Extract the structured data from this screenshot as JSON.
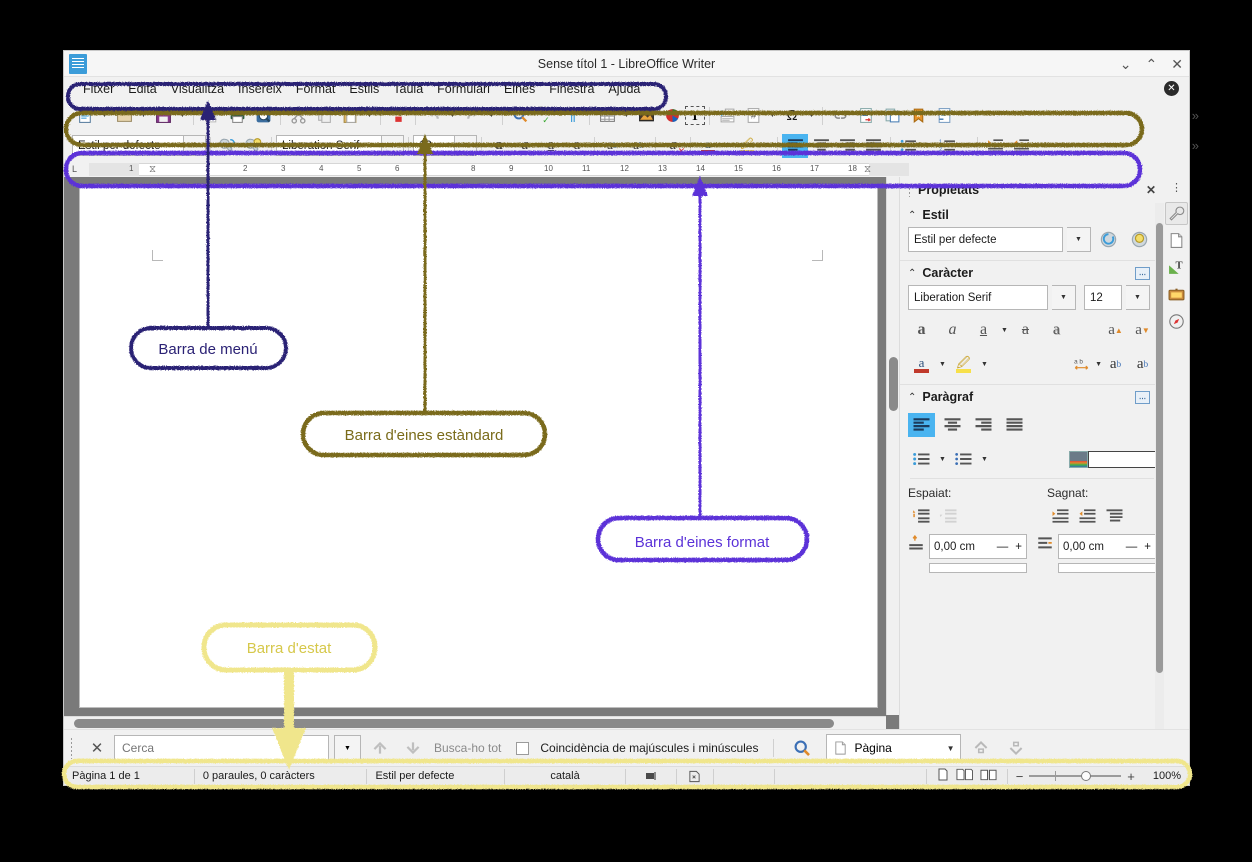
{
  "window": {
    "title": "Sense títol 1 - LibreOffice Writer",
    "app_icon": "writer-document-icon",
    "controls": {
      "minimize": "⌄",
      "maximize": "⌃",
      "close": "✕",
      "doc_close": "✕"
    }
  },
  "menubar": {
    "items": [
      "Fitxer",
      "Edita",
      "Visualitza",
      "Insereix",
      "Format",
      "Estils",
      "Taula",
      "Formulari",
      "Eines",
      "Finestra",
      "Ajuda"
    ]
  },
  "standard_toolbar": {
    "overflow": "»",
    "items": [
      {
        "name": "new-document-icon",
        "glyph": "🗎",
        "dropdown": true
      },
      {
        "name": "open-document-icon",
        "glyph": "📁",
        "dropdown": true
      },
      {
        "name": "save-document-icon",
        "glyph": "💾",
        "dropdown": true
      },
      {
        "sep": true
      },
      {
        "name": "export-pdf-icon",
        "glyph": "◣",
        "dropdown": false
      },
      {
        "name": "print-icon",
        "glyph": "🖨",
        "dropdown": false
      },
      {
        "name": "print-preview-icon",
        "glyph": "🔍",
        "dropdown": false
      },
      {
        "sep": true
      },
      {
        "name": "cut-icon",
        "glyph": "✂",
        "dropdown": false
      },
      {
        "name": "copy-icon",
        "glyph": "⧉",
        "dropdown": false
      },
      {
        "name": "paste-icon",
        "glyph": "📋",
        "dropdown": true
      },
      {
        "sep": true
      },
      {
        "name": "clone-formatting-icon",
        "glyph": "🖌",
        "dropdown": false
      },
      {
        "sep": true
      },
      {
        "name": "undo-icon",
        "glyph": "↺",
        "dropdown": true
      },
      {
        "name": "redo-icon",
        "glyph": "↻",
        "dropdown": true
      },
      {
        "sep": true
      },
      {
        "name": "find-replace-icon",
        "glyph": "🔍",
        "dropdown": false
      },
      {
        "name": "spelling-icon",
        "glyph": "Abc",
        "dropdown": false
      },
      {
        "name": "formatting-marks-icon",
        "glyph": "¶",
        "dropdown": false
      },
      {
        "sep": true
      },
      {
        "name": "insert-table-icon",
        "glyph": "⊞",
        "dropdown": true
      },
      {
        "name": "insert-image-icon",
        "glyph": "🖼",
        "dropdown": false
      },
      {
        "name": "insert-chart-icon",
        "glyph": "◕",
        "dropdown": false
      },
      {
        "name": "insert-text-box-icon",
        "glyph": "T",
        "dropdown": false
      },
      {
        "sep": true
      },
      {
        "name": "page-break-icon",
        "glyph": "▤",
        "dropdown": false
      },
      {
        "name": "insert-field-icon",
        "glyph": "#",
        "dropdown": true
      },
      {
        "name": "special-character-icon",
        "glyph": "Ω",
        "dropdown": true
      },
      {
        "sep": true
      },
      {
        "name": "insert-hyperlink-icon",
        "glyph": "⛓",
        "dropdown": false
      },
      {
        "name": "insert-footnote-icon",
        "glyph": "🗐",
        "dropdown": false
      },
      {
        "name": "insert-endnote-icon",
        "glyph": "🗏",
        "dropdown": false
      },
      {
        "name": "insert-bookmark-icon",
        "glyph": "🔖",
        "dropdown": false
      },
      {
        "name": "insert-cross-reference-icon",
        "glyph": "🗒",
        "dropdown": false
      }
    ]
  },
  "format_toolbar": {
    "overflow": "»",
    "paragraph_style": "Estil per defecte",
    "font_name": "Liberation Serif",
    "font_size": "12",
    "items": [
      {
        "name": "update-style-icon",
        "glyph": "⟳"
      },
      {
        "name": "new-style-icon",
        "glyph": "☆"
      },
      {
        "name": "bold-icon",
        "glyph": "a"
      },
      {
        "name": "italic-icon",
        "glyph": "𝑎"
      },
      {
        "name": "underline-icon",
        "glyph": "a",
        "dropdown": true
      },
      {
        "name": "strikethrough-icon",
        "glyph": "a"
      },
      {
        "name": "shadow-icon",
        "glyph": "a"
      },
      {
        "name": "superscript-icon",
        "glyph": "ab"
      },
      {
        "name": "subscript-icon",
        "glyph": "ab"
      },
      {
        "name": "clear-formatting-icon",
        "glyph": "a"
      },
      {
        "name": "font-color-icon",
        "glyph": "a",
        "dropdown": true
      },
      {
        "name": "highlight-color-icon",
        "glyph": "🖉",
        "dropdown": true
      },
      {
        "name": "align-left-icon",
        "glyph": "≡",
        "active": true
      },
      {
        "name": "align-center-icon",
        "glyph": "≡"
      },
      {
        "name": "align-right-icon",
        "glyph": "≡"
      },
      {
        "name": "align-justified-icon",
        "glyph": "≡"
      },
      {
        "name": "unordered-list-icon",
        "glyph": "⁞≡",
        "dropdown": true
      },
      {
        "name": "ordered-list-icon",
        "glyph": "1≡",
        "dropdown": true
      },
      {
        "name": "increase-indent-icon",
        "glyph": "≡"
      },
      {
        "name": "decrease-indent-icon",
        "glyph": "≡"
      }
    ]
  },
  "ruler": {
    "ticks": [
      "1",
      "1",
      "2",
      "3",
      "4",
      "5",
      "6",
      "8",
      "9",
      "10",
      "11",
      "12",
      "13",
      "14",
      "15",
      "16",
      "17",
      "18"
    ],
    "left_corner": "L"
  },
  "sidebar": {
    "title": "Propietats",
    "close_label": "✕",
    "menu_glyph": "⋮",
    "sections": {
      "style": {
        "title": "Estil",
        "value": "Estil per defecte",
        "buttons": [
          {
            "name": "update-selected-style-icon",
            "glyph": "⟳"
          },
          {
            "name": "new-style-from-selection-icon",
            "glyph": "☆"
          }
        ]
      },
      "character": {
        "title": "Caràcter",
        "font_name": "Liberation Serif",
        "font_size": "12",
        "row1": [
          {
            "name": "bold-icon",
            "glyph": "a"
          },
          {
            "name": "italic-icon",
            "glyph": "𝑎"
          },
          {
            "name": "underline-icon",
            "glyph": "a",
            "dropdown": true
          },
          {
            "name": "strikethrough-icon",
            "glyph": "a"
          },
          {
            "name": "shadow-icon",
            "glyph": "a"
          }
        ],
        "row1_right": [
          {
            "name": "increase-font-size-icon",
            "glyph": "a"
          },
          {
            "name": "decrease-font-size-icon",
            "glyph": "a"
          }
        ],
        "row2": [
          {
            "name": "font-color-icon",
            "glyph": "a",
            "dropdown": true
          },
          {
            "name": "highlight-color-icon",
            "glyph": "🖉",
            "dropdown": true
          }
        ],
        "row2_right": [
          {
            "name": "character-spacing-icon",
            "glyph": "ab",
            "dropdown": true
          },
          {
            "name": "superscript-icon",
            "glyph": "ab"
          },
          {
            "name": "subscript-icon",
            "glyph": "ab"
          }
        ]
      },
      "paragraph": {
        "title": "Paràgraf",
        "align": [
          {
            "name": "align-left-icon",
            "glyph": "≡",
            "active": true
          },
          {
            "name": "align-center-icon",
            "glyph": "≡",
            "active": false
          },
          {
            "name": "align-right-icon",
            "glyph": "≡",
            "active": false
          },
          {
            "name": "align-justified-icon",
            "glyph": "≡",
            "active": false
          }
        ],
        "lists": [
          {
            "name": "unordered-list-icon",
            "glyph": "≡",
            "dropdown": true
          },
          {
            "name": "ordered-list-icon",
            "glyph": "≡",
            "dropdown": true
          }
        ],
        "background_label": "paragraph-background-color",
        "spacing_label": "Espaiat:",
        "indent_label": "Sagnat:",
        "spacing_buttons": [
          {
            "name": "increase-paragraph-spacing-icon",
            "glyph": "⬓"
          },
          {
            "name": "decrease-paragraph-spacing-icon",
            "glyph": "⬒"
          }
        ],
        "indent_buttons": [
          {
            "name": "increase-indent-icon",
            "glyph": "⇥"
          },
          {
            "name": "decrease-indent-icon",
            "glyph": "⇤"
          },
          {
            "name": "hanging-indent-icon",
            "glyph": "⇱"
          }
        ],
        "above_spacing_value": "0,00 cm",
        "before_indent_value": "0,00 cm",
        "minus": "—",
        "plus": "+"
      }
    },
    "tabs": [
      {
        "name": "sidebar-tab-properties",
        "glyph": "🔧",
        "active": true
      },
      {
        "name": "sidebar-tab-page",
        "glyph": "🗎",
        "active": false
      },
      {
        "name": "sidebar-tab-styles",
        "glyph": "T",
        "active": false
      },
      {
        "name": "sidebar-tab-gallery",
        "glyph": "🖼",
        "active": false
      },
      {
        "name": "sidebar-tab-navigator",
        "glyph": "🧭",
        "active": false
      }
    ]
  },
  "findbar": {
    "close_label": "✕",
    "search_placeholder": "Cerca",
    "search_value": "",
    "dropdown": "▾",
    "find_previous": "find-previous-icon",
    "find_next": "find-next-icon",
    "find_all_label": "Busca-ho tot",
    "match_case_label": "Coincidència de majúscules i minúscules",
    "match_case_checked": false,
    "find_replace_icon": "find-and-replace-icon",
    "navigate_by_value": "Pàgina",
    "prev_label": "previous-page-icon",
    "next_label": "next-page-icon"
  },
  "statusbar": {
    "page": "Pàgina 1 de 1",
    "words": "0 paraules, 0 caràcters",
    "style": "Estil per defecte",
    "language": "català",
    "insert_mode_icon": "overwrite-mode-icon",
    "selection_mode_icon": "selection-mode-icon",
    "digital_signature": "",
    "view_single": "single-page-view-icon",
    "view_multi": "multi-page-view-icon",
    "view_book": "book-view-icon",
    "zoom_out": "−",
    "zoom_in": "+",
    "zoom_level": "100%"
  },
  "annotations": [
    {
      "name": "menu-bar-callout",
      "label": "Barra de menú",
      "color": "#2b2275"
    },
    {
      "name": "standard-toolbar-callout",
      "label": "Barra d'eines estàndard",
      "color": "#7a6b1a"
    },
    {
      "name": "format-toolbar-callout",
      "label": "Barra d'eines format",
      "color": "#5b32d8"
    },
    {
      "name": "status-bar-callout",
      "label": "Barra d'estat",
      "color": "#f0e68c"
    }
  ],
  "colors": {
    "menu_highlight": "#2b2275",
    "standard_highlight": "#7a6b1a",
    "format_highlight": "#5b32d8",
    "status_highlight": "#f0e68c",
    "accent": "#4ab4f0"
  }
}
